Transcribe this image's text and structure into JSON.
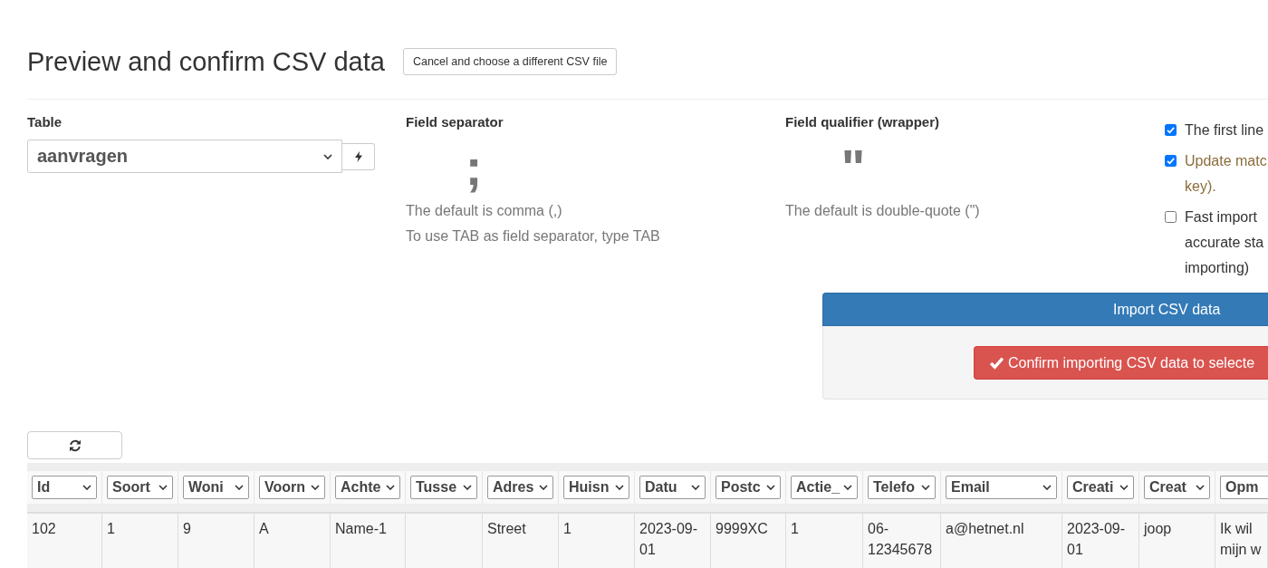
{
  "page": {
    "title": "Preview and confirm CSV data",
    "cancel_button": "Cancel and choose a different CSV file"
  },
  "table_picker": {
    "label": "Table",
    "value": "aanvragen"
  },
  "field_separator": {
    "label": "Field separator",
    "value": ";",
    "hints": [
      "The default is comma (,)",
      "To use TAB as field separator, type TAB"
    ]
  },
  "field_qualifier": {
    "label": "Field qualifier (wrapper)",
    "value": "\"",
    "hints": [
      "The default is double-quote (\")"
    ]
  },
  "options": [
    {
      "kind": "plain",
      "checked": true,
      "lines": [
        "The first line"
      ]
    },
    {
      "kind": "warning",
      "checked": true,
      "lines": [
        "Update matc",
        "key)."
      ]
    },
    {
      "kind": "plain",
      "checked": false,
      "lines": [
        "Fast import",
        "accurate sta",
        "importing)"
      ]
    }
  ],
  "import_button": "Import CSV data",
  "confirm_button": "Confirm importing CSV data to selecte",
  "preview": {
    "columns": [
      "Id",
      "Soort",
      "Woni",
      "Voorn",
      "Achte",
      "Tusse",
      "Adres",
      "Huisn",
      "Datu",
      "Postc",
      "Actie_",
      "Telefo",
      "Email",
      "Creati",
      "Creat",
      "Opm"
    ],
    "rows": [
      {
        "cells": [
          "102",
          "1",
          "9",
          "A",
          "Name-1",
          null,
          "Street",
          "1",
          "2023-09-01",
          "9999XC",
          "1",
          "06-12345678",
          "a@hetnet.nl",
          "2023-09-01",
          "joop",
          "Ik wil mijn w"
        ]
      }
    ]
  }
}
